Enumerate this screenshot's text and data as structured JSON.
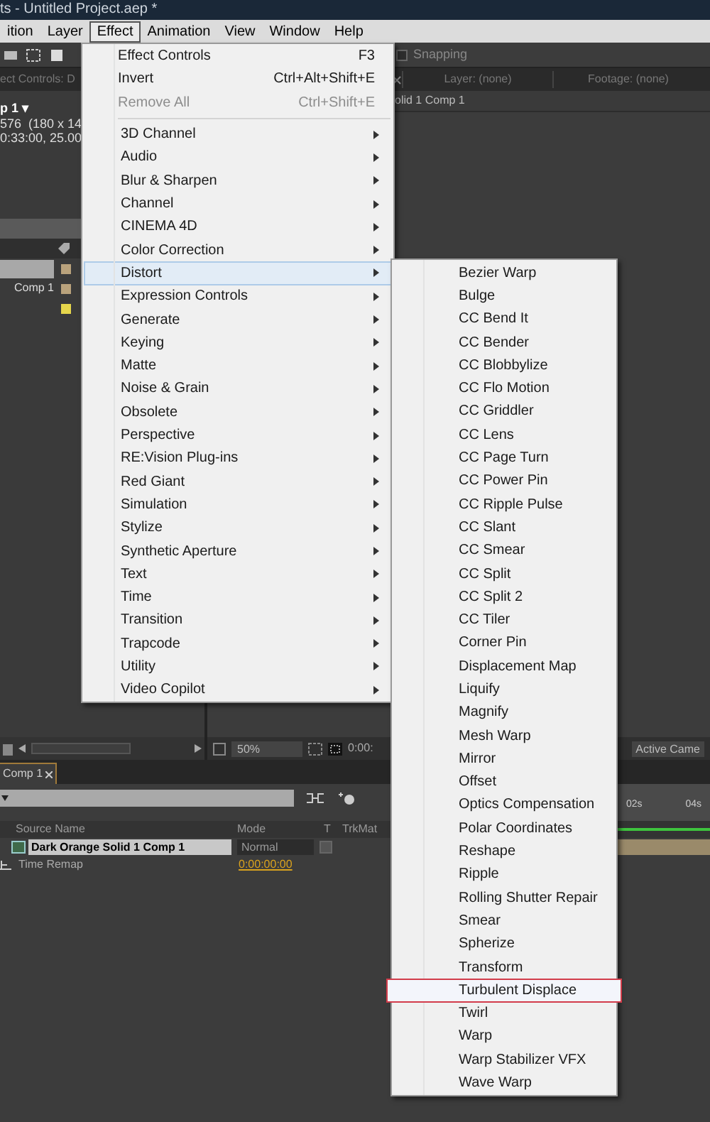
{
  "window": {
    "title": "ts - Untitled Project.aep *"
  },
  "menu_bar": [
    {
      "label": "ition",
      "selected": false
    },
    {
      "label": "Layer",
      "selected": false
    },
    {
      "label": "Effect",
      "selected": true
    },
    {
      "label": "Animation",
      "selected": false
    },
    {
      "label": "View",
      "selected": false
    },
    {
      "label": "Window",
      "selected": false
    },
    {
      "label": "Help",
      "selected": false
    }
  ],
  "toolbar": {
    "snapping": {
      "label": "Snapping",
      "checked": false
    }
  },
  "effect_controls_panel": {
    "tab": "ect Controls: D",
    "comp_name": "p 1 ▾",
    "lines": [
      "576  (180 x 14",
      "0:33:00, 25.00"
    ]
  },
  "project_items": [
    {
      "color": "#b9a27c",
      "selected": true
    },
    {
      "name": "Comp 1",
      "color": "#b9a27c",
      "selected": false
    },
    {
      "color": "#e6d64c",
      "selected": false
    }
  ],
  "viewer": {
    "tabs": [
      "Layer: (none)",
      "Footage: (none)"
    ],
    "comp_label": "olid 1 Comp 1",
    "zoom": "50%",
    "timecode": "0:00:",
    "camera": "Active Came"
  },
  "timeline": {
    "tab": "Comp 1",
    "columns": [
      "Source Name",
      "Mode",
      "T",
      "TrkMat"
    ],
    "layer": {
      "name": "Dark Orange Solid 1 Comp 1",
      "mode": "Normal",
      "selected": true,
      "track_matte_checked": false
    },
    "property": {
      "name": "Time Remap",
      "value": "0:00:00:00"
    },
    "ruler": [
      "02s",
      "04s"
    ]
  },
  "effect_menu": {
    "commands": [
      {
        "label": "Effect Controls",
        "shortcut": "F3",
        "disabled": false
      },
      {
        "label": "Invert",
        "shortcut": "Ctrl+Alt+Shift+E",
        "disabled": false
      },
      {
        "label": "Remove All",
        "shortcut": "Ctrl+Shift+E",
        "disabled": true
      }
    ],
    "categories": [
      {
        "label": "3D Channel",
        "selected": false
      },
      {
        "label": "Audio",
        "selected": false
      },
      {
        "label": "Blur & Sharpen",
        "selected": false
      },
      {
        "label": "Channel",
        "selected": false
      },
      {
        "label": "CINEMA 4D",
        "selected": false
      },
      {
        "label": "Color Correction",
        "selected": false
      },
      {
        "label": "Distort",
        "selected": true
      },
      {
        "label": "Expression Controls",
        "selected": false
      },
      {
        "label": "Generate",
        "selected": false
      },
      {
        "label": "Keying",
        "selected": false
      },
      {
        "label": "Matte",
        "selected": false
      },
      {
        "label": "Noise & Grain",
        "selected": false
      },
      {
        "label": "Obsolete",
        "selected": false
      },
      {
        "label": "Perspective",
        "selected": false
      },
      {
        "label": "RE:Vision Plug-ins",
        "selected": false
      },
      {
        "label": "Red Giant",
        "selected": false
      },
      {
        "label": "Simulation",
        "selected": false
      },
      {
        "label": "Stylize",
        "selected": false
      },
      {
        "label": "Synthetic Aperture",
        "selected": false
      },
      {
        "label": "Text",
        "selected": false
      },
      {
        "label": "Time",
        "selected": false
      },
      {
        "label": "Transition",
        "selected": false
      },
      {
        "label": "Trapcode",
        "selected": false
      },
      {
        "label": "Utility",
        "selected": false
      },
      {
        "label": "Video Copilot",
        "selected": false
      }
    ]
  },
  "distort_submenu": [
    {
      "label": "Bezier Warp",
      "selected": false
    },
    {
      "label": "Bulge",
      "selected": false
    },
    {
      "label": "CC Bend It",
      "selected": false
    },
    {
      "label": "CC Bender",
      "selected": false
    },
    {
      "label": "CC Blobbylize",
      "selected": false
    },
    {
      "label": "CC Flo Motion",
      "selected": false
    },
    {
      "label": "CC Griddler",
      "selected": false
    },
    {
      "label": "CC Lens",
      "selected": false
    },
    {
      "label": "CC Page Turn",
      "selected": false
    },
    {
      "label": "CC Power Pin",
      "selected": false
    },
    {
      "label": "CC Ripple Pulse",
      "selected": false
    },
    {
      "label": "CC Slant",
      "selected": false
    },
    {
      "label": "CC Smear",
      "selected": false
    },
    {
      "label": "CC Split",
      "selected": false
    },
    {
      "label": "CC Split 2",
      "selected": false
    },
    {
      "label": "CC Tiler",
      "selected": false
    },
    {
      "label": "Corner Pin",
      "selected": false
    },
    {
      "label": "Displacement Map",
      "selected": false
    },
    {
      "label": "Liquify",
      "selected": false
    },
    {
      "label": "Magnify",
      "selected": false
    },
    {
      "label": "Mesh Warp",
      "selected": false
    },
    {
      "label": "Mirror",
      "selected": false
    },
    {
      "label": "Offset",
      "selected": false
    },
    {
      "label": "Optics Compensation",
      "selected": false
    },
    {
      "label": "Polar Coordinates",
      "selected": false
    },
    {
      "label": "Reshape",
      "selected": false
    },
    {
      "label": "Ripple",
      "selected": false
    },
    {
      "label": "Rolling Shutter Repair",
      "selected": false
    },
    {
      "label": "Smear",
      "selected": false
    },
    {
      "label": "Spherize",
      "selected": false
    },
    {
      "label": "Transform",
      "selected": false
    },
    {
      "label": "Turbulent Displace",
      "selected": true
    },
    {
      "label": "Twirl",
      "selected": false
    },
    {
      "label": "Warp",
      "selected": false
    },
    {
      "label": "Warp Stabilizer VFX",
      "selected": false
    },
    {
      "label": "Wave Warp",
      "selected": false
    }
  ]
}
